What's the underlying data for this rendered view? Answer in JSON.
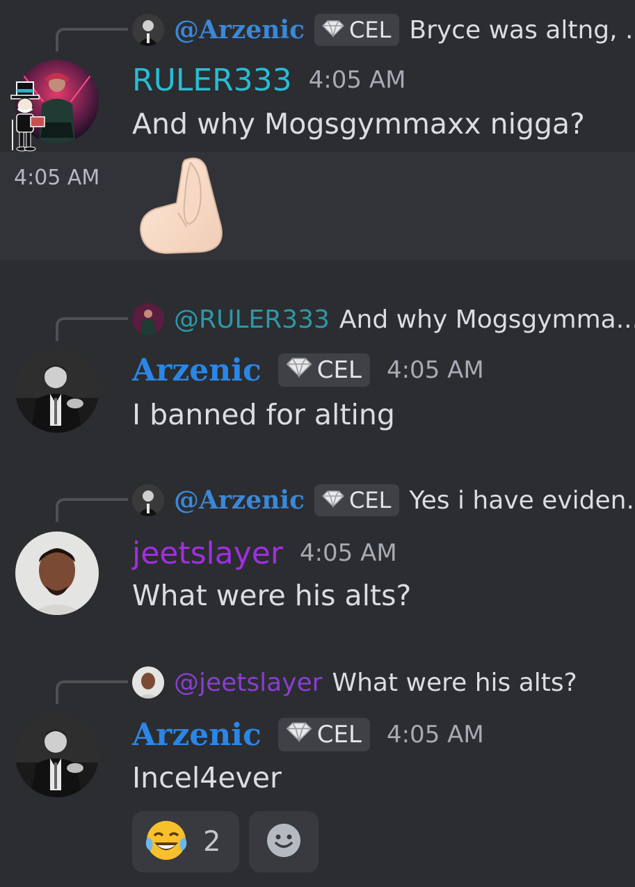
{
  "messages": [
    {
      "reply": {
        "mention": "@Arzenic",
        "tag": "CEL",
        "text": "Bryce was altng, .."
      },
      "author": "RULER333",
      "time": "4:05 AM",
      "lines": [
        "And why Mogsgymmaxx nigga?"
      ],
      "followup": {
        "time": "4:05 AM",
        "emoji": "pinched-fingers"
      }
    },
    {
      "reply": {
        "mention": "@RULER333",
        "text": "And why Mogsgymma..."
      },
      "author": "Arzenic",
      "tag": "CEL",
      "time": "4:05 AM",
      "text": "I banned for alting"
    },
    {
      "reply": {
        "mention": "@Arzenic",
        "tag": "CEL",
        "text": "Yes i have eviden.."
      },
      "author": "jeetslayer",
      "time": "4:05 AM",
      "text": "What were his alts?"
    },
    {
      "reply": {
        "mention": "@jeetslayer",
        "text": "What were his alts?"
      },
      "author": "Arzenic",
      "tag": "CEL",
      "time": "4:05 AM",
      "text": "Incel4ever",
      "reactions": [
        {
          "emoji": "joy-emoji",
          "count": "2"
        },
        {
          "emoji": "add-reaction-icon"
        }
      ]
    }
  ],
  "colors": {
    "background": "#2b2d31",
    "arzenic": "#2b86e6",
    "ruler333": "#29bcd4",
    "jeetslayer": "#a02fe0"
  }
}
